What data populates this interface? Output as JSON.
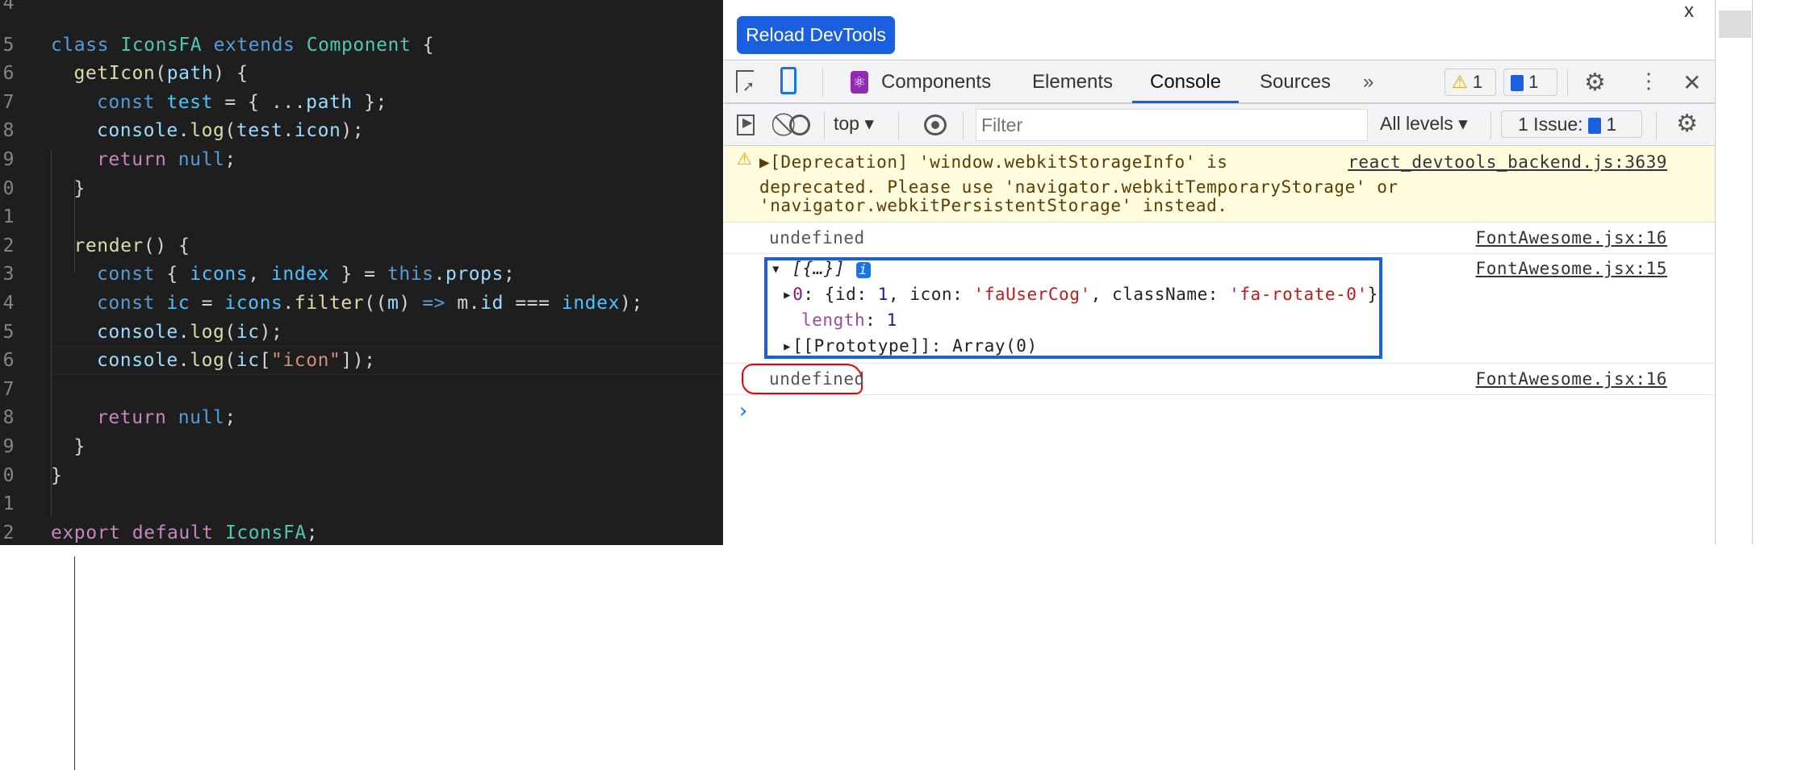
{
  "editor": {
    "lines": [
      {
        "num": "4",
        "tokens": []
      },
      {
        "num": "5",
        "indent": 0,
        "tokens": [
          {
            "t": "class ",
            "c": "kw"
          },
          {
            "t": "IconsFA ",
            "c": "ty"
          },
          {
            "t": "extends ",
            "c": "kw"
          },
          {
            "t": "Component ",
            "c": "ty"
          },
          {
            "t": "{",
            "c": ""
          }
        ]
      },
      {
        "num": "6",
        "indent": 1,
        "tokens": [
          {
            "t": "getIcon",
            "c": "fn"
          },
          {
            "t": "(",
            "c": ""
          },
          {
            "t": "path",
            "c": "vr"
          },
          {
            "t": ") {",
            "c": ""
          }
        ]
      },
      {
        "num": "7",
        "indent": 2,
        "tokens": [
          {
            "t": "const ",
            "c": "kw"
          },
          {
            "t": "test",
            "c": "ct"
          },
          {
            "t": " = { ...",
            "c": ""
          },
          {
            "t": "path",
            "c": "vr"
          },
          {
            "t": " };",
            "c": ""
          }
        ]
      },
      {
        "num": "8",
        "indent": 2,
        "tokens": [
          {
            "t": "console",
            "c": "vr"
          },
          {
            "t": ".",
            "c": ""
          },
          {
            "t": "log",
            "c": "fn"
          },
          {
            "t": "(",
            "c": ""
          },
          {
            "t": "test",
            "c": "vr"
          },
          {
            "t": ".",
            "c": ""
          },
          {
            "t": "icon",
            "c": "vr"
          },
          {
            "t": ");",
            "c": ""
          }
        ]
      },
      {
        "num": "9",
        "indent": 2,
        "tokens": [
          {
            "t": "return ",
            "c": "rt"
          },
          {
            "t": "null",
            "c": "kw"
          },
          {
            "t": ";",
            "c": ""
          }
        ]
      },
      {
        "num": "0",
        "indent": 1,
        "tokens": [
          {
            "t": "}",
            "c": ""
          }
        ]
      },
      {
        "num": "1",
        "tokens": []
      },
      {
        "num": "2",
        "indent": 1,
        "tokens": [
          {
            "t": "render",
            "c": "fn"
          },
          {
            "t": "() {",
            "c": ""
          }
        ]
      },
      {
        "num": "3",
        "indent": 2,
        "tokens": [
          {
            "t": "const ",
            "c": "kw"
          },
          {
            "t": "{ ",
            "c": ""
          },
          {
            "t": "icons",
            "c": "ct"
          },
          {
            "t": ", ",
            "c": ""
          },
          {
            "t": "index",
            "c": "ct"
          },
          {
            "t": " } = ",
            "c": ""
          },
          {
            "t": "this",
            "c": "kw"
          },
          {
            "t": ".",
            "c": ""
          },
          {
            "t": "props",
            "c": "vr"
          },
          {
            "t": ";",
            "c": ""
          }
        ]
      },
      {
        "num": "4",
        "indent": 2,
        "tokens": [
          {
            "t": "const ",
            "c": "kw"
          },
          {
            "t": "ic",
            "c": "ct"
          },
          {
            "t": " = ",
            "c": ""
          },
          {
            "t": "icons",
            "c": "ct"
          },
          {
            "t": ".",
            "c": ""
          },
          {
            "t": "filter",
            "c": "fn"
          },
          {
            "t": "((",
            "c": ""
          },
          {
            "t": "m",
            "c": "vr"
          },
          {
            "t": ") ",
            "c": ""
          },
          {
            "t": "=>",
            "c": "kw"
          },
          {
            "t": " m.",
            "c": ""
          },
          {
            "t": "id",
            "c": "vr"
          },
          {
            "t": " === ",
            "c": ""
          },
          {
            "t": "index",
            "c": "ct"
          },
          {
            "t": ");",
            "c": ""
          }
        ]
      },
      {
        "num": "5",
        "indent": 2,
        "tokens": [
          {
            "t": "console",
            "c": "vr"
          },
          {
            "t": ".",
            "c": ""
          },
          {
            "t": "log",
            "c": "fn"
          },
          {
            "t": "(",
            "c": ""
          },
          {
            "t": "ic",
            "c": "vr"
          },
          {
            "t": ");",
            "c": ""
          }
        ]
      },
      {
        "num": "6",
        "indent": 2,
        "current": true,
        "tokens": [
          {
            "t": "console",
            "c": "vr"
          },
          {
            "t": ".",
            "c": ""
          },
          {
            "t": "log",
            "c": "fn"
          },
          {
            "t": "(",
            "c": ""
          },
          {
            "t": "ic",
            "c": "vr"
          },
          {
            "t": "[",
            "c": ""
          },
          {
            "t": "\"icon\"",
            "c": "st"
          },
          {
            "t": "]);",
            "c": ""
          }
        ]
      },
      {
        "num": "7",
        "tokens": []
      },
      {
        "num": "8",
        "indent": 2,
        "tokens": [
          {
            "t": "return ",
            "c": "rt"
          },
          {
            "t": "null",
            "c": "kw"
          },
          {
            "t": ";",
            "c": ""
          }
        ]
      },
      {
        "num": "9",
        "indent": 1,
        "tokens": [
          {
            "t": "}",
            "c": ""
          }
        ]
      },
      {
        "num": "0",
        "indent": 0,
        "tokens": [
          {
            "t": "}",
            "c": ""
          }
        ]
      },
      {
        "num": "1",
        "tokens": []
      },
      {
        "num": "2",
        "indent": 0,
        "tokens": [
          {
            "t": "export ",
            "c": "rt"
          },
          {
            "t": "default ",
            "c": "rt"
          },
          {
            "t": "IconsFA",
            "c": "ty"
          },
          {
            "t": ";",
            "c": ""
          }
        ]
      }
    ]
  },
  "devtools": {
    "reload_label": "Reload DevTools",
    "close_glyph": "x",
    "tabs": {
      "components": "Components",
      "elements": "Elements",
      "console": "Console",
      "sources": "Sources",
      "more": "»"
    },
    "warn_count": "1",
    "info_count": "1",
    "toolbar": {
      "context": "top",
      "filter_placeholder": "Filter",
      "levels": "All levels",
      "issues_label": "1 Issue:",
      "issues_count": "1"
    },
    "colors": {
      "accent": "#1a5fe0",
      "warning_bg": "#fffbdd"
    },
    "messages": {
      "warning": {
        "line1": "▶[Deprecation] 'window.webkitStorageInfo' is",
        "line2": "deprecated. Please use 'navigator.webkitTemporaryStorage' or",
        "line3": "'navigator.webkitPersistentStorage' instead.",
        "source": "react_devtools_backend.js:3639"
      },
      "log1": {
        "text": "undefined",
        "source": "FontAwesome.jsx:16"
      },
      "log2": {
        "header": "[{…}]",
        "info": "i",
        "source": "FontAwesome.jsx:15",
        "item_key": "0",
        "item_open": ": {id: ",
        "id": "1",
        "item_mid": ", icon: ",
        "icon": "'faUserCog'",
        "item_mid2": ", className: ",
        "className": "'fa-rotate-0'",
        "item_close": "}",
        "length_key": "length",
        "length_val": "1",
        "proto": "[[Prototype]]: Array(0)"
      },
      "log3": {
        "text": "undefined",
        "source": "FontAwesome.jsx:16"
      }
    },
    "prompt": "›"
  }
}
